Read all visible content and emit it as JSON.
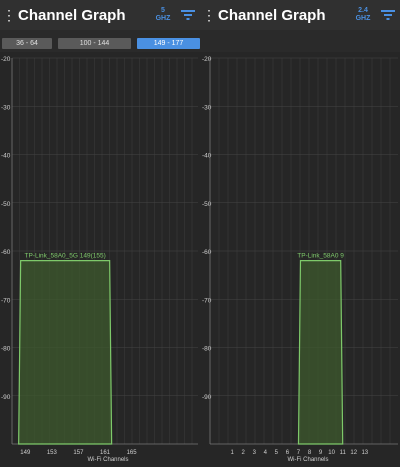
{
  "screens": [
    {
      "title": "Channel Graph",
      "band": "5 GHZ",
      "band_lines": [
        "5",
        "GHZ"
      ],
      "range_tabs": [
        {
          "label": "36 - 64",
          "selected": false
        },
        {
          "label": "100 - 144",
          "selected": false
        },
        {
          "label": "149 - 177",
          "selected": true
        }
      ],
      "chart_data": {
        "type": "area",
        "title": "",
        "xlabel": "Wi-Fi Channels",
        "ylabel": "",
        "ylim": [
          -100,
          -20
        ],
        "y_ticks": [
          -20,
          -30,
          -40,
          -50,
          -60,
          -70,
          -80,
          -90
        ],
        "x_ticks": [
          "149",
          "153",
          "157",
          "161",
          "165"
        ],
        "xlim": [
          147,
          175
        ],
        "grid": true,
        "series": [
          {
            "name": "TP-Link_58A0_5G 149(155)",
            "center": 155,
            "signal": -62,
            "start": 148,
            "end": 162,
            "color": "#7ec96a"
          }
        ]
      }
    },
    {
      "title": "Channel Graph",
      "band": "2.4 GHZ",
      "band_lines": [
        "2.4",
        "GHZ"
      ],
      "range_tabs": [],
      "chart_data": {
        "type": "area",
        "title": "",
        "xlabel": "Wi-Fi Channels",
        "ylabel": "",
        "ylim": [
          -100,
          -20
        ],
        "y_ticks": [
          -20,
          -30,
          -40,
          -50,
          -60,
          -70,
          -80,
          -90
        ],
        "x_ticks": [
          "1",
          "2",
          "3",
          "4",
          "5",
          "6",
          "7",
          "8",
          "9",
          "10",
          "11",
          "12",
          "13"
        ],
        "xlim": [
          -1,
          16
        ],
        "grid": true,
        "series": [
          {
            "name": "TP-Link_58A0 9",
            "center": 9,
            "signal": -62,
            "start": 7,
            "end": 11,
            "color": "#7ec96a"
          }
        ]
      }
    }
  ],
  "colors": {
    "accent": "#4a90e2",
    "signal": "#7ec96a",
    "tab_bg": "#5a5a5a",
    "tab_selected_bg": "#4a90e2"
  },
  "icons": {
    "menu": "more-vert-icon",
    "filter": "filter-icon"
  }
}
